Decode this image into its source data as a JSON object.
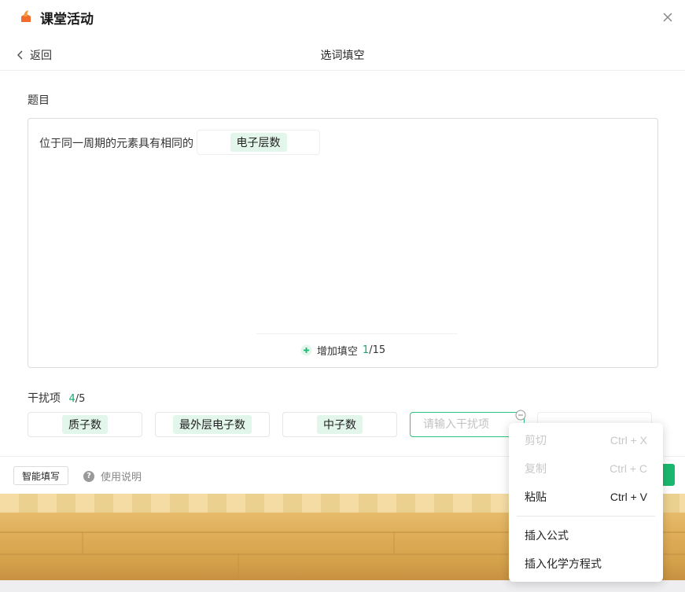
{
  "app": {
    "title": "课堂活动",
    "close_icon": "close-icon",
    "logo_icon": "app-logo-icon"
  },
  "nav": {
    "back_label": "返回",
    "page_title": "选词填空"
  },
  "question": {
    "label": "题目",
    "text": "位于同一周期的元素具有相同的",
    "answer": "电子层数",
    "add_blank_label": "增加填空",
    "blank_count": "1",
    "blank_max": "/15"
  },
  "distractors": {
    "label": "干扰项",
    "count": "4",
    "max": "/5",
    "items": [
      "质子数",
      "最外层电子数",
      "中子数"
    ],
    "input_placeholder": "请输入干扰项"
  },
  "footer": {
    "smart_fill_label": "智能填写",
    "help_label": "使用说明"
  },
  "context_menu": {
    "items": [
      {
        "label": "剪切",
        "shortcut": "Ctrl + X",
        "enabled": false
      },
      {
        "label": "复制",
        "shortcut": "Ctrl + C",
        "enabled": false
      },
      {
        "label": "粘贴",
        "shortcut": "Ctrl + V",
        "enabled": true
      },
      {
        "label": "插入公式",
        "shortcut": "",
        "enabled": true
      },
      {
        "label": "插入化学方程式",
        "shortcut": "",
        "enabled": true
      }
    ]
  },
  "colors": {
    "accent": "#1bb76e",
    "chip_bg": "#e3f6ec",
    "logo": "#f26b2a"
  }
}
